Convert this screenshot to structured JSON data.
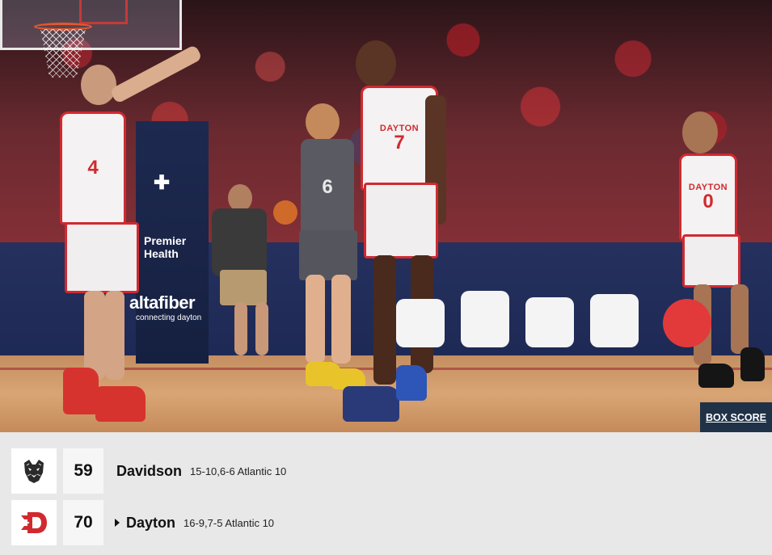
{
  "photo": {
    "ads": {
      "premier_health_line1": "Premier",
      "premier_health_line2": "Health",
      "altafiber": "altafiber",
      "altafiber_tagline": "connecting dayton"
    },
    "players": [
      {
        "team": "Dayton",
        "name": "",
        "number": "4"
      },
      {
        "team": "Davidson",
        "name": "",
        "number": "6"
      },
      {
        "team": "Dayton",
        "name": "DAYTON",
        "number": "7"
      },
      {
        "team": "Dayton",
        "name": "DAYTON",
        "number": "0"
      }
    ]
  },
  "box_score_button": "BOX SCORE",
  "scoreboard": {
    "teams": [
      {
        "logo_icon": "davidson-wildcat-icon",
        "score": "59",
        "name": "Davidson",
        "record": "15-10,6-6 Atlantic 10",
        "winner": false
      },
      {
        "logo_icon": "dayton-flyers-icon",
        "score": "70",
        "name": "Dayton",
        "record": "16-9,7-5 Atlantic 10",
        "winner": true
      }
    ]
  },
  "colors": {
    "dayton_red": "#d02a30",
    "button_navy": "#203247",
    "panel_gray": "#e8e8e8"
  }
}
